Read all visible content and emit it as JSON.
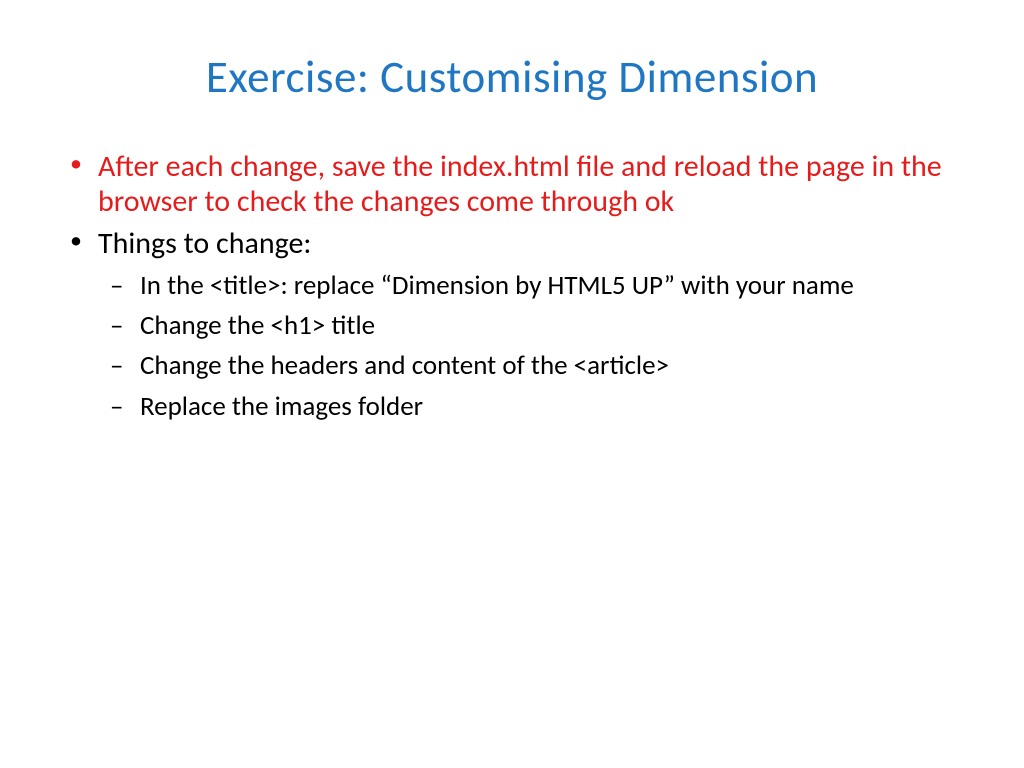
{
  "title": "Exercise: Customising Dimension",
  "bullets": {
    "item1": "After each change, save the index.html file and reload the page in the browser to check the changes come through ok",
    "item2": "Things to change:",
    "sub1": "In the <title>: replace “Dimension by HTML5 UP” with your name",
    "sub2": "Change the <h1> title",
    "sub3": "Change the headers and content of the <article>",
    "sub4": "Replace the images folder"
  }
}
